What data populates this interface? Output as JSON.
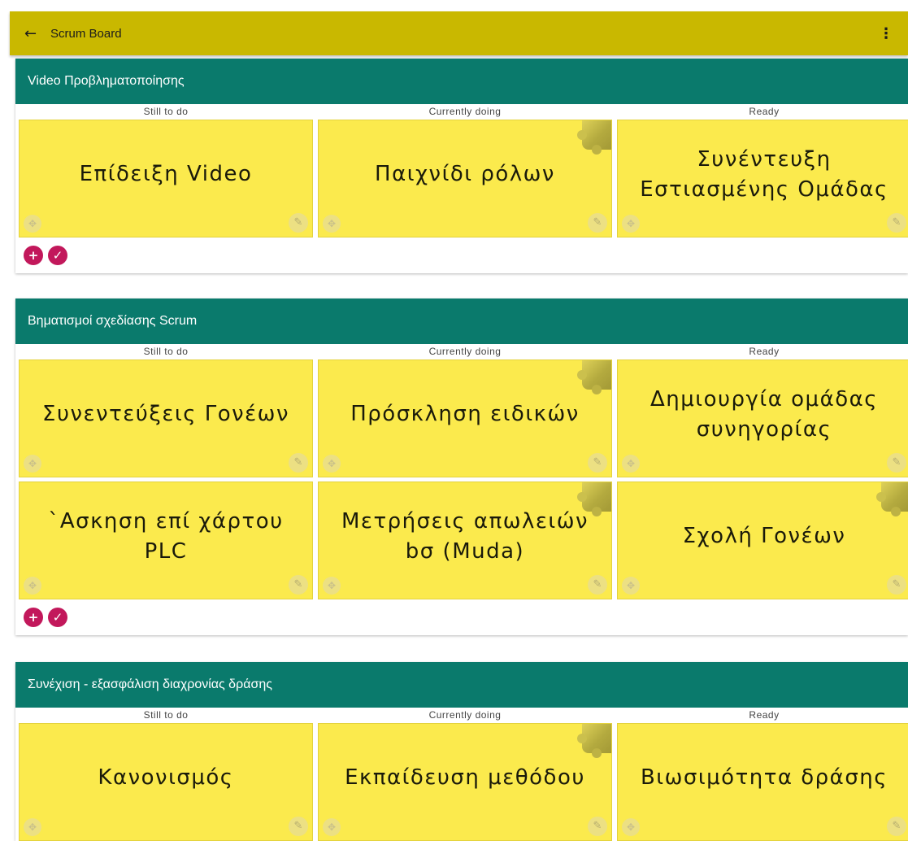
{
  "appbar": {
    "back_icon": "arrow-left-icon",
    "title": "Scrum Board",
    "more_icon": "more-vert-icon"
  },
  "columns": [
    "Still to do",
    "Currently doing",
    "Ready"
  ],
  "sections": [
    {
      "title": "Video Προβληματοποίησης",
      "notes": [
        {
          "text": "Επίδειξη Video",
          "column": "Still to do",
          "has_puzzle": false
        },
        {
          "text": "Παιχνίδι ρόλων",
          "column": "Currently doing",
          "has_puzzle": true
        },
        {
          "text": "Συνέντευξη Εστιασμένης Ομάδας",
          "column": "Ready",
          "has_puzzle": false
        }
      ]
    },
    {
      "title": "Βηματισμοί σχεδίασης Scrum",
      "notes": [
        {
          "text": "Συνεντεύξεις Γονέων",
          "column": "Still to do",
          "has_puzzle": false
        },
        {
          "text": "Πρόσκληση ειδικών",
          "column": "Currently doing",
          "has_puzzle": true
        },
        {
          "text": "Δημιουργία ομάδας συνηγορίας",
          "column": "Ready",
          "has_puzzle": false
        },
        {
          "text": "`Ασκηση επί χάρτου PLC",
          "column": "Still to do",
          "has_puzzle": false
        },
        {
          "text": "Μετρήσεις απωλειών bσ (Muda)",
          "column": "Currently doing",
          "has_puzzle": true
        },
        {
          "text": "Σχολή Γονέων",
          "column": "Ready",
          "has_puzzle": true
        }
      ]
    },
    {
      "title": "Συνέχιση - εξασφάλιση διαχρονίας δράσης",
      "notes": [
        {
          "text": "Κανονισμός",
          "column": "Still to do",
          "has_puzzle": false
        },
        {
          "text": "Εκπαίδευση μεθόδου",
          "column": "Currently doing",
          "has_puzzle": true
        },
        {
          "text": "Βιωσιμότητα δράσης",
          "column": "Ready",
          "has_puzzle": false
        }
      ]
    }
  ],
  "note_icons": {
    "move": "drag-move-icon",
    "edit": "pencil-edit-icon",
    "attachment": "puzzle-attachment-icon"
  },
  "actions": {
    "add_icon": "plus-icon",
    "done_icon": "check-icon"
  },
  "colors": {
    "appbar": "#c9b800",
    "section_header": "#0a7a6c",
    "note": "#fbea4d",
    "fab": "#c2185b"
  }
}
